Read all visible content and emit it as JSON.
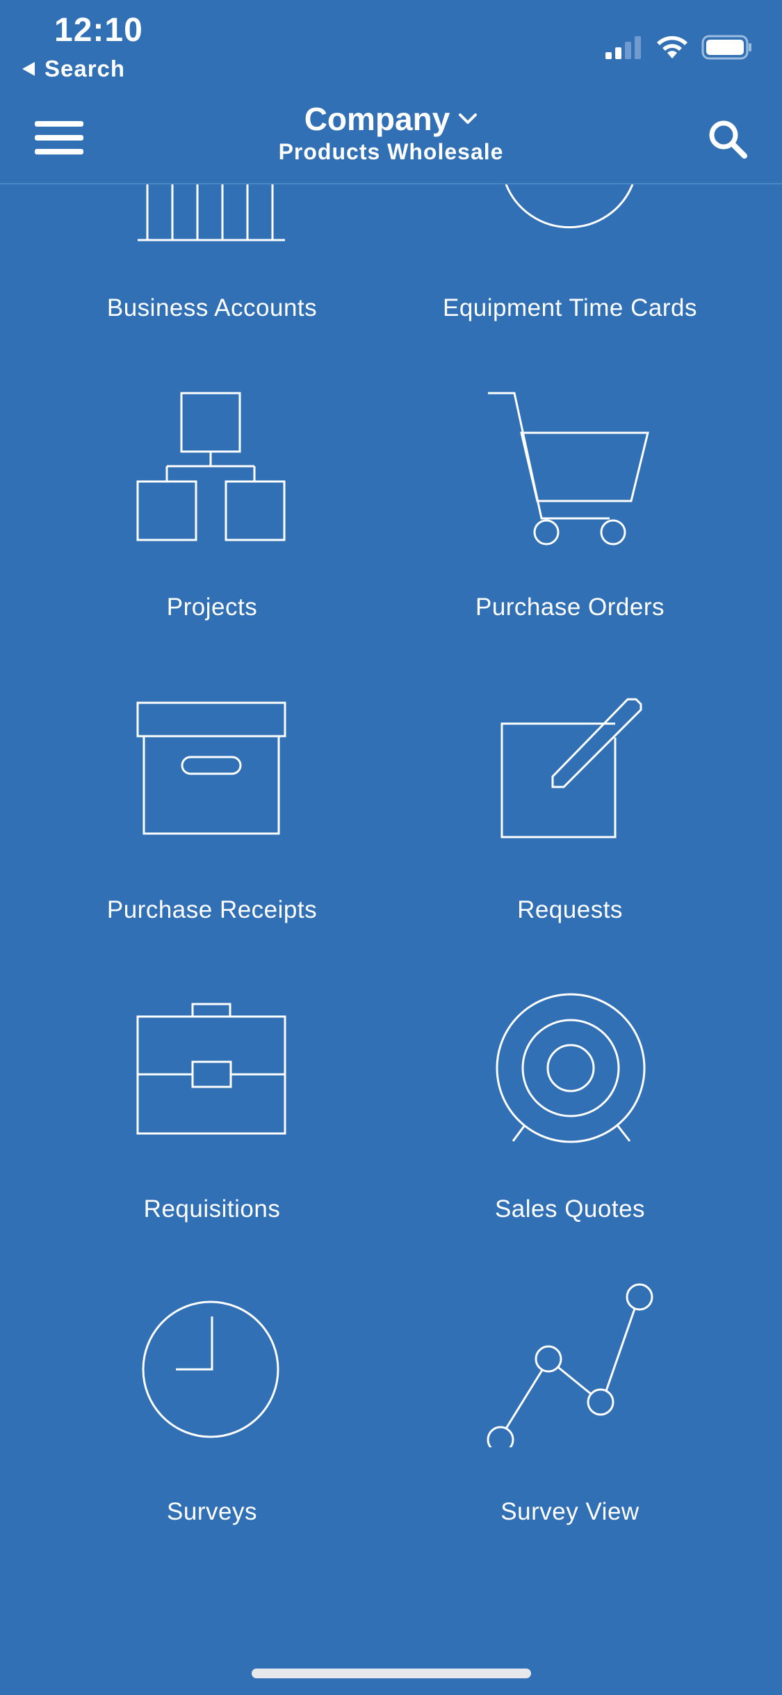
{
  "status_bar": {
    "time": "12:10",
    "back_label": "Search",
    "icons": [
      "cellular-signal-icon",
      "wifi-icon",
      "battery-icon"
    ]
  },
  "header": {
    "title": "Company",
    "subtitle": "Products Wholesale",
    "icons": [
      "hamburger-menu-icon",
      "chevron-down-icon",
      "search-icon"
    ]
  },
  "tiles": [
    {
      "label": "Business Accounts",
      "icon": "building-icon"
    },
    {
      "label": "Equipment Time Cards",
      "icon": "clock-icon"
    },
    {
      "label": "Projects",
      "icon": "hierarchy-icon"
    },
    {
      "label": "Purchase Orders",
      "icon": "shopping-cart-icon"
    },
    {
      "label": "Purchase Receipts",
      "icon": "archive-box-icon"
    },
    {
      "label": "Requests",
      "icon": "edit-square-icon"
    },
    {
      "label": "Requisitions",
      "icon": "briefcase-icon"
    },
    {
      "label": "Sales Quotes",
      "icon": "target-icon"
    },
    {
      "label": "Surveys",
      "icon": "clock-icon"
    },
    {
      "label": "Survey View",
      "icon": "line-chart-icon"
    }
  ],
  "colors": {
    "background": "#3170b4",
    "foreground": "#ffffff",
    "home_indicator": "#e6e8ec"
  }
}
